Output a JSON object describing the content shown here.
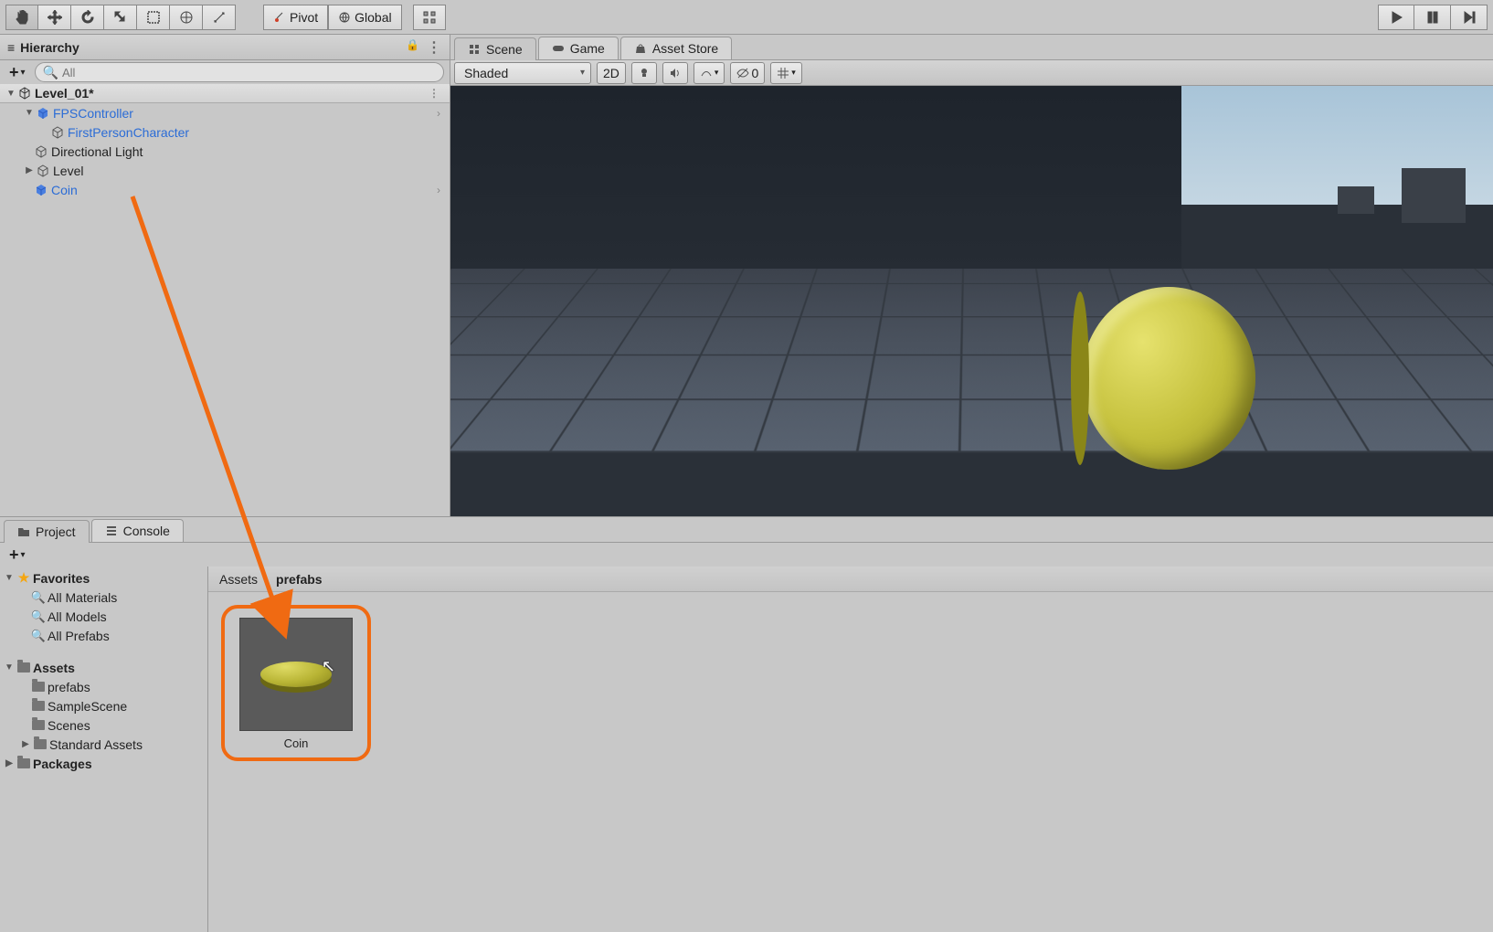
{
  "toolbar": {
    "pivot_label": "Pivot",
    "global_label": "Global"
  },
  "hierarchy": {
    "title": "Hierarchy",
    "search_placeholder": "All",
    "scene": "Level_01*",
    "items": [
      {
        "label": "FPSController",
        "prefab": true,
        "indent": 1,
        "arrow": true,
        "expand": true
      },
      {
        "label": "FirstPersonCharacter",
        "prefab": true,
        "indent": 2,
        "outline": true
      },
      {
        "label": "Directional Light",
        "prefab": false,
        "indent": 1,
        "outline": true
      },
      {
        "label": "Level",
        "prefab": false,
        "indent": 1,
        "outline": true,
        "collapsed": true
      },
      {
        "label": "Coin",
        "prefab": true,
        "indent": 1,
        "arrow": true
      }
    ]
  },
  "scene": {
    "tabs": [
      "Scene",
      "Game",
      "Asset Store"
    ],
    "shading": "Shaded",
    "mode_2d": "2D",
    "gizmo_count": "0"
  },
  "project": {
    "tabs": [
      "Project",
      "Console"
    ],
    "favorites_label": "Favorites",
    "favorites": [
      "All Materials",
      "All Models",
      "All Prefabs"
    ],
    "assets_label": "Assets",
    "assets_folders": [
      "prefabs",
      "SampleScene",
      "Scenes",
      "Standard Assets"
    ],
    "packages_label": "Packages",
    "breadcrumb": [
      "Assets",
      "prefabs"
    ],
    "items": [
      {
        "name": "Coin"
      }
    ]
  }
}
